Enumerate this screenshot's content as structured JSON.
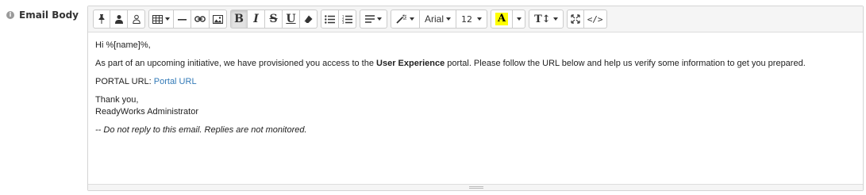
{
  "field": {
    "label": "Email Body",
    "info_icon": "i"
  },
  "toolbar": {
    "font_family": "Arial",
    "font_size": "12",
    "highlight_letter": "A",
    "line_height_label": "T↕",
    "code_view_label": "</>",
    "highlight_color": "#ffff00",
    "bold": "B",
    "italic": "I",
    "strike": "S",
    "underline": "U"
  },
  "content": {
    "greeting": "Hi %[name]%,",
    "intro_before": "As part of an upcoming initiative, we have provisioned you access to the ",
    "intro_bold": "User Experience",
    "intro_after": " portal. Please follow the URL below and help us verify some information to get you prepared.",
    "portal_label": "PORTAL URL: ",
    "portal_link": "Portal URL",
    "thanks": "Thank you,",
    "signature": "ReadyWorks Administrator",
    "footer_note": "-- Do not reply to this email. Replies are not monitored."
  },
  "colors": {
    "link": "#337ab7",
    "toolbar_bg": "#f5f5f5",
    "border": "#d4d4d4"
  }
}
